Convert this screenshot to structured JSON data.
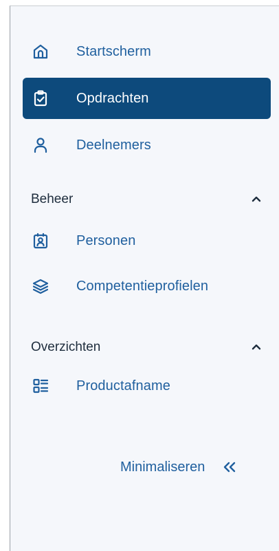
{
  "colors": {
    "accent": "#1f5f9e",
    "active_bg": "#0d4a7c",
    "active_text": "#ffffff",
    "sidebar_bg": "#f5f7fb",
    "section_text": "#1e2d3d"
  },
  "nav": {
    "items": [
      {
        "label": "Startscherm",
        "icon": "home-icon",
        "active": false
      },
      {
        "label": "Opdrachten",
        "icon": "clipboard-check-icon",
        "active": true
      },
      {
        "label": "Deelnemers",
        "icon": "person-icon",
        "active": false
      }
    ]
  },
  "sections": [
    {
      "title": "Beheer",
      "expanded": true,
      "items": [
        {
          "label": "Personen",
          "icon": "id-badge-icon"
        },
        {
          "label": "Competentieprofielen",
          "icon": "layers-icon"
        }
      ]
    },
    {
      "title": "Overzichten",
      "expanded": true,
      "items": [
        {
          "label": "Productafname",
          "icon": "list-grid-icon"
        }
      ]
    }
  ],
  "footer": {
    "minimize_label": "Minimaliseren",
    "minimize_icon": "double-chevron-left-icon"
  }
}
